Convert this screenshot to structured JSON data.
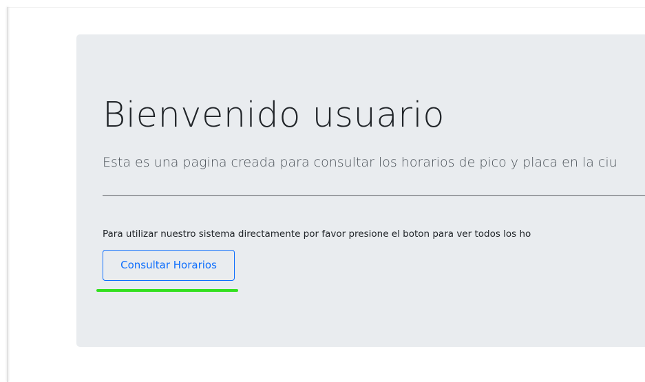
{
  "jumbotron": {
    "title": "Bienvenido usuario",
    "lead": "Esta es una pagina creada para consultar los horarios de pico y placa en la ciu",
    "body": "Para utilizar nuestro sistema directamente por favor presione el boton para ver todos los ho",
    "button_label": "Consultar Horarios"
  },
  "colors": {
    "jumbotron_bg": "#e9ecef",
    "button_accent": "#0d6efd",
    "highlight": "#33e01f"
  }
}
